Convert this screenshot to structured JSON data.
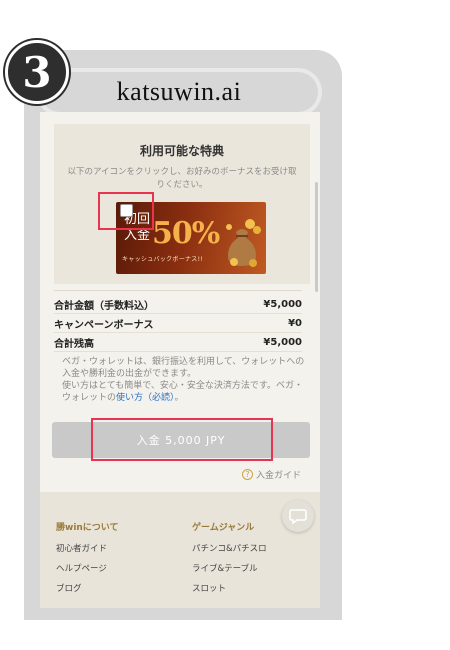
{
  "step": {
    "number": "3"
  },
  "browser": {
    "url": "katsuwin.ai"
  },
  "benefits": {
    "title": "利用可能な特典",
    "description": "以下のアイコンをクリックし、お好みのボーナスをお受け取りください。",
    "promo": {
      "first_deposit": "初回\n入金",
      "percent": "50%",
      "sub": "キャッシュバックボーナス!!"
    }
  },
  "summary": {
    "rows": [
      {
        "label": "合計金額（手数料込）",
        "value": "¥5,000"
      },
      {
        "label": "キャンペーンボーナス",
        "value": "¥0"
      },
      {
        "label": "合計残高",
        "value": "¥5,000"
      }
    ],
    "note_before": "ベガ・ウォレットは、銀行振込を利用して、ウォレットへの入金や勝利金の出金ができます。\n使い方はとても簡単で、安心・安全な決済方法です。ベガ・ウォレットの",
    "note_link": "使い方（必読）",
    "note_after": "。"
  },
  "deposit_button": {
    "label": "入金 5,000 JPY"
  },
  "guide": {
    "icon": "question-icon",
    "label": "入金ガイド"
  },
  "footer": {
    "col1": {
      "heading": "勝winについて",
      "items": [
        "初心者ガイド",
        "ヘルプページ",
        "ブログ"
      ]
    },
    "col2": {
      "heading": "ゲームジャンル",
      "items": [
        "パチンコ&パチスロ",
        "ライブ&テーブル",
        "スロット"
      ]
    }
  },
  "colors": {
    "highlight": "#e8344e",
    "gold": "#9a7a3a",
    "link": "#2b6fc2"
  }
}
